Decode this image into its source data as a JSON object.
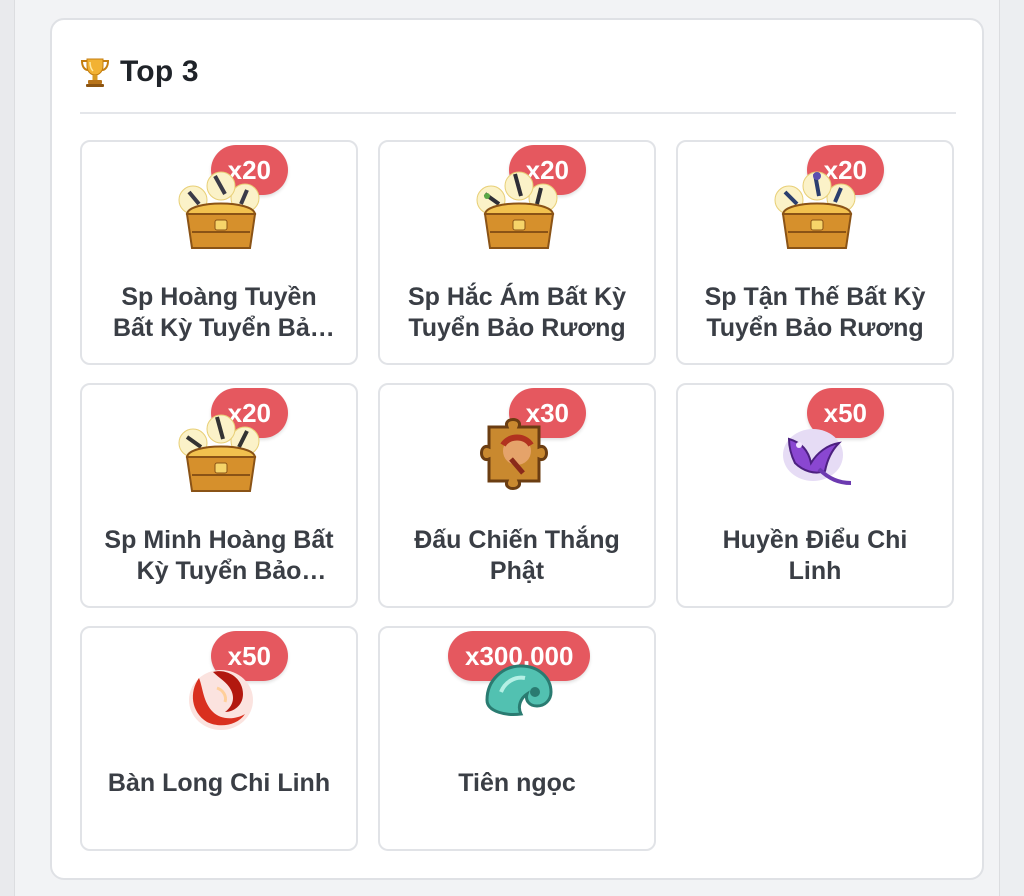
{
  "section": {
    "title": "Top 3",
    "icon": "trophy-icon"
  },
  "items": [
    {
      "name": "Sp Hoàng Tuyền Bất Kỳ Tuyển Bảo Rương",
      "qty": "x20",
      "icon": "treasure-chest-icon"
    },
    {
      "name": "Sp Hắc Ám Bất Kỳ Tuyển Bảo Rương",
      "qty": "x20",
      "icon": "treasure-chest-icon"
    },
    {
      "name": "Sp Tận Thế Bất Kỳ Tuyển Bảo Rương",
      "qty": "x20",
      "icon": "treasure-chest-icon"
    },
    {
      "name": "Sp Minh Hoàng Bất Kỳ Tuyển Bảo Rương",
      "qty": "x20",
      "icon": "treasure-chest-icon"
    },
    {
      "name": "Đấu Chiến Thắng Phật",
      "qty": "x30",
      "icon": "puzzle-piece-icon"
    },
    {
      "name": "Huyền Điểu Chi Linh",
      "qty": "x50",
      "icon": "purple-bird-spirit-icon"
    },
    {
      "name": "Bàn Long Chi Linh",
      "qty": "x50",
      "icon": "red-dragon-spirit-icon"
    },
    {
      "name": "Tiên ngọc",
      "qty": "x300,000",
      "icon": "jade-gem-icon"
    }
  ],
  "colors": {
    "badge": "#e5585f",
    "card_border": "#e1e3e7",
    "text": "#3a3e45"
  }
}
